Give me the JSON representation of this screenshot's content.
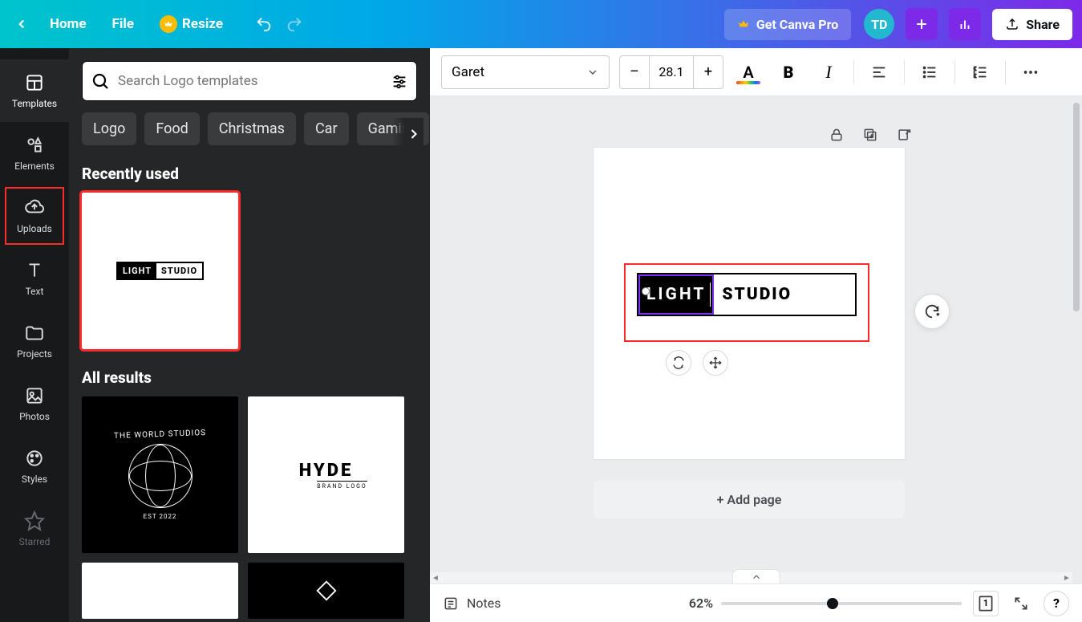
{
  "topbar": {
    "home": "Home",
    "file": "File",
    "resize": "Resize",
    "get_pro": "Get Canva Pro",
    "avatar": "TD",
    "share": "Share"
  },
  "rail": {
    "templates": "Templates",
    "elements": "Elements",
    "uploads": "Uploads",
    "text": "Text",
    "projects": "Projects",
    "photos": "Photos",
    "styles": "Styles",
    "starred": "Starred"
  },
  "panel": {
    "search_placeholder": "Search Logo templates",
    "chips": [
      "Logo",
      "Food",
      "Christmas",
      "Car",
      "Gaming"
    ],
    "section_recent": "Recently used",
    "section_all": "All results",
    "recent_thumb": {
      "left": "LIGHT",
      "right": "STUDIO"
    },
    "world_thumb": {
      "top": "THE WORLD STUDIOS",
      "est": "EST 2022"
    },
    "hyde_thumb": {
      "title": "HYDE",
      "sub": "BRAND LOGO"
    }
  },
  "toolbar": {
    "font": "Garet",
    "size": "28.1"
  },
  "canvas": {
    "light": "LIGHT",
    "studio": "STUDIO",
    "add_page": "+ Add page"
  },
  "footer": {
    "notes": "Notes",
    "zoom": "62%",
    "page_count": "1"
  }
}
